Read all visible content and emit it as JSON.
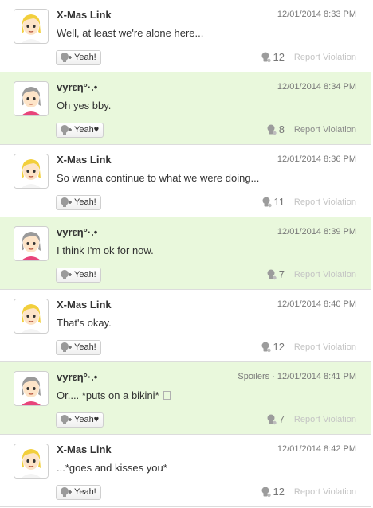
{
  "posts": [
    {
      "user": "X-Mas Link",
      "avatar": "blonde",
      "meta": "12/01/2014 8:33 PM",
      "text": "Well, at least we're alone here...",
      "yeah": "Yeah!",
      "count": "12",
      "report": "Report Violation",
      "green": false,
      "report_active": false
    },
    {
      "user": "vyrεη°·.•",
      "avatar": "grey",
      "meta": "12/01/2014 8:34 PM",
      "text": "Oh yes bby.",
      "yeah": "Yeah♥",
      "count": "8",
      "report": "Report Violation",
      "green": true,
      "report_active": true
    },
    {
      "user": "X-Mas Link",
      "avatar": "blonde",
      "meta": "12/01/2014 8:36 PM",
      "text": "So wanna continue to what we were doing...",
      "yeah": "Yeah!",
      "count": "11",
      "report": "Report Violation",
      "green": false,
      "report_active": false
    },
    {
      "user": "vyrεη°·.•",
      "avatar": "grey",
      "meta": "12/01/2014 8:39 PM",
      "text": "I think I'm ok for now.",
      "yeah": "Yeah!",
      "count": "7",
      "report": "Report Violation",
      "green": true,
      "report_active": false
    },
    {
      "user": "X-Mas Link",
      "avatar": "blonde",
      "meta": "12/01/2014 8:40 PM",
      "text": "That's okay.",
      "yeah": "Yeah!",
      "count": "12",
      "report": "Report Violation",
      "green": false,
      "report_active": false
    },
    {
      "user": "vyrεη°·.•",
      "avatar": "grey",
      "spoiler": "Spoilers · ",
      "meta": "12/01/2014 8:41 PM",
      "text": "Or.... *puts on a bikini*",
      "trailing_box": true,
      "yeah": "Yeah♥",
      "count": "7",
      "report": "Report Violation",
      "green": true,
      "report_active": false
    },
    {
      "user": "X-Mas Link",
      "avatar": "blonde",
      "meta": "12/01/2014 8:42 PM",
      "text": "...*goes and kisses you*",
      "yeah": "Yeah!",
      "count": "12",
      "report": "Report Violation",
      "green": false,
      "report_active": false
    }
  ],
  "colors": {
    "green_row": "#e9f8dc",
    "blonde_hair": "#f2cf3c",
    "grey_hair": "#9a9a9a",
    "skin": "#fde4c8"
  }
}
